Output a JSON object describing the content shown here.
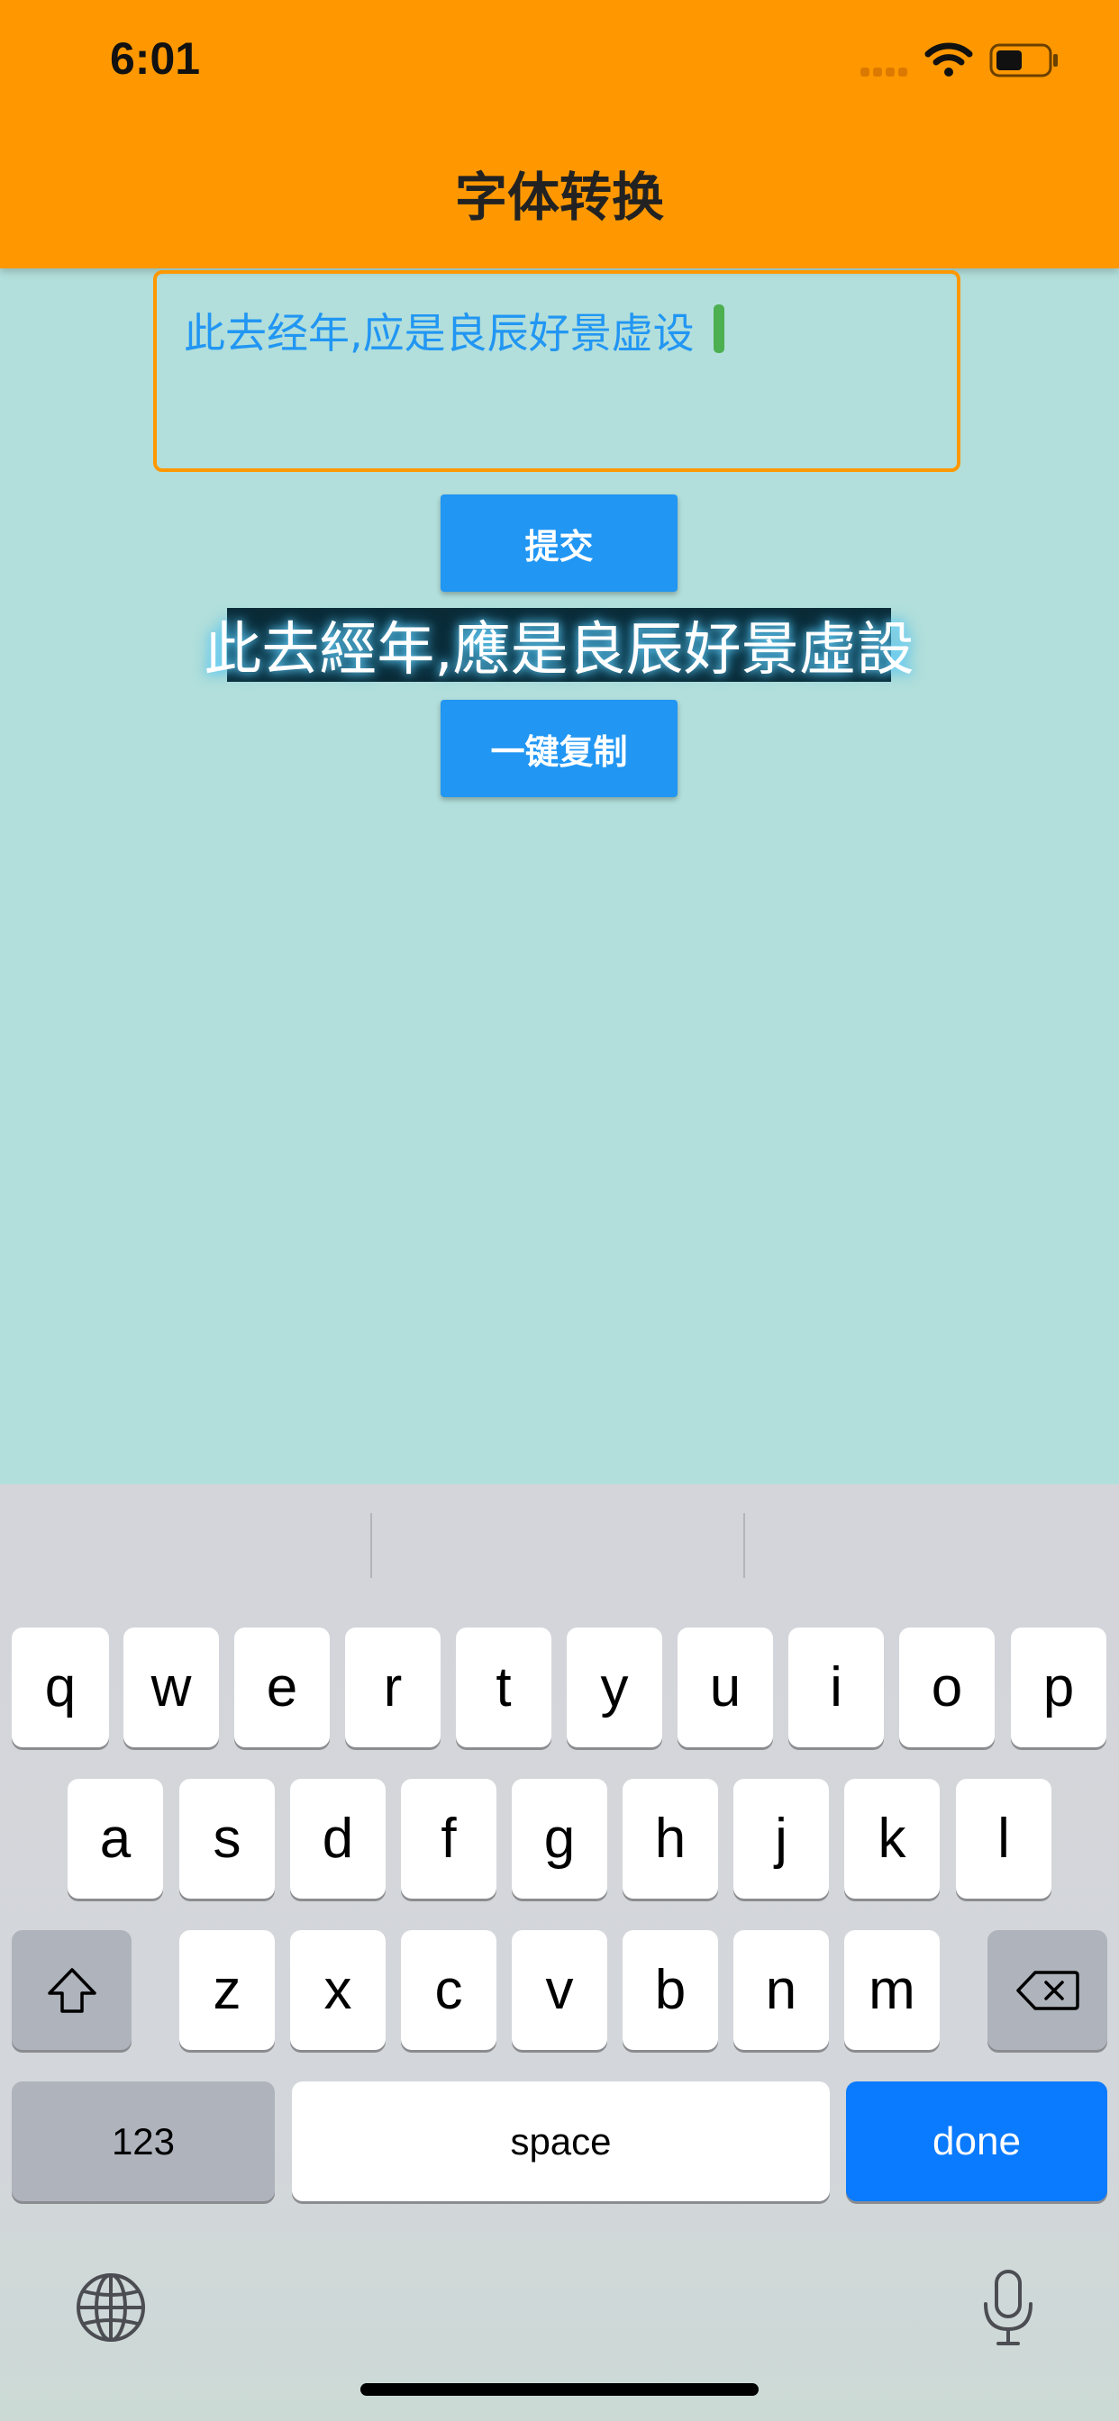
{
  "status_bar": {
    "time": "6:01"
  },
  "header": {
    "title": "字体转换"
  },
  "input": {
    "value": "此去经年,应是良辰好景虚设"
  },
  "buttons": {
    "submit_label": "提交",
    "copy_label": "一键复制"
  },
  "result": {
    "text": "此去經年,應是良辰好景虛設"
  },
  "keyboard": {
    "row1": [
      "q",
      "w",
      "e",
      "r",
      "t",
      "y",
      "u",
      "i",
      "o",
      "p"
    ],
    "row2": [
      "a",
      "s",
      "d",
      "f",
      "g",
      "h",
      "j",
      "k",
      "l"
    ],
    "row3": [
      "z",
      "x",
      "c",
      "v",
      "b",
      "n",
      "m"
    ],
    "numbers_label": "123",
    "space_label": "space",
    "done_label": "done"
  },
  "colors": {
    "header": "#ff9800",
    "background": "#b2dfdb",
    "button": "#2196f3",
    "input_text": "#2196f3",
    "done_key": "#0a7aff"
  }
}
